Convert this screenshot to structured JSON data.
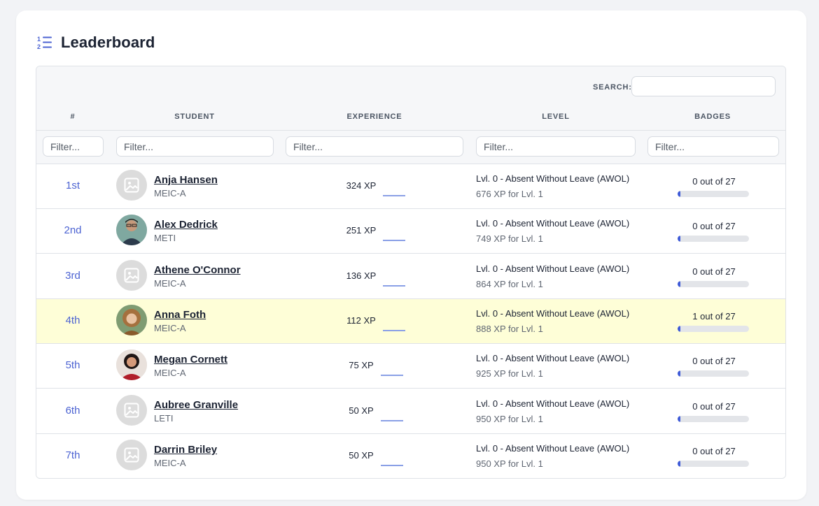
{
  "header": {
    "title": "Leaderboard",
    "icon": "ordered-list-icon"
  },
  "table": {
    "search_label": "SEARCH:",
    "search_value": "",
    "columns": [
      "#",
      "STUDENT",
      "EXPERIENCE",
      "LEVEL",
      "BADGES"
    ],
    "filter_placeholder": "Filter...",
    "rows": [
      {
        "rank": "1st",
        "name": "Anja Hansen",
        "group": "MEIC-A",
        "xp": "324 XP",
        "level": "Lvl. 0 - Absent Without Leave (AWOL)",
        "next": "676 XP for Lvl. 1",
        "badges": "0 out of 27",
        "badges_fraction": 0.0,
        "avatar": "placeholder-image-icon",
        "highlight": false
      },
      {
        "rank": "2nd",
        "name": "Alex Dedrick",
        "group": "METI",
        "xp": "251 XP",
        "level": "Lvl. 0 - Absent Without Leave (AWOL)",
        "next": "749 XP for Lvl. 1",
        "badges": "0 out of 27",
        "badges_fraction": 0.0,
        "avatar": "photo-man-glasses",
        "highlight": false
      },
      {
        "rank": "3rd",
        "name": "Athene O'Connor",
        "group": "MEIC-A",
        "xp": "136 XP",
        "level": "Lvl. 0 - Absent Without Leave (AWOL)",
        "next": "864 XP for Lvl. 1",
        "badges": "0 out of 27",
        "badges_fraction": 0.0,
        "avatar": "placeholder-image-icon",
        "highlight": false
      },
      {
        "rank": "4th",
        "name": "Anna Foth",
        "group": "MEIC-A",
        "xp": "112 XP",
        "level": "Lvl. 0 - Absent Without Leave (AWOL)",
        "next": "888 XP for Lvl. 1",
        "badges": "1 out of 27",
        "badges_fraction": 0.037,
        "avatar": "photo-woman-curly",
        "highlight": true
      },
      {
        "rank": "5th",
        "name": "Megan Cornett",
        "group": "MEIC-A",
        "xp": "75 XP",
        "level": "Lvl. 0 - Absent Without Leave (AWOL)",
        "next": "925 XP for Lvl. 1",
        "badges": "0 out of 27",
        "badges_fraction": 0.0,
        "avatar": "photo-woman-red",
        "highlight": false
      },
      {
        "rank": "6th",
        "name": "Aubree Granville",
        "group": "LETI",
        "xp": "50 XP",
        "level": "Lvl. 0 - Absent Without Leave (AWOL)",
        "next": "950 XP for Lvl. 1",
        "badges": "0 out of 27",
        "badges_fraction": 0.0,
        "avatar": "placeholder-image-icon",
        "highlight": false
      },
      {
        "rank": "7th",
        "name": "Darrin Briley",
        "group": "MEIC-A",
        "xp": "50 XP",
        "level": "Lvl. 0 - Absent Without Leave (AWOL)",
        "next": "950 XP for Lvl. 1",
        "badges": "0 out of 27",
        "badges_fraction": 0.0,
        "avatar": "placeholder-image-icon",
        "highlight": false
      }
    ]
  },
  "colors": {
    "accent": "#4c63d2",
    "highlight_row": "#fefed7",
    "badge_fill": "#3f5bd8"
  }
}
